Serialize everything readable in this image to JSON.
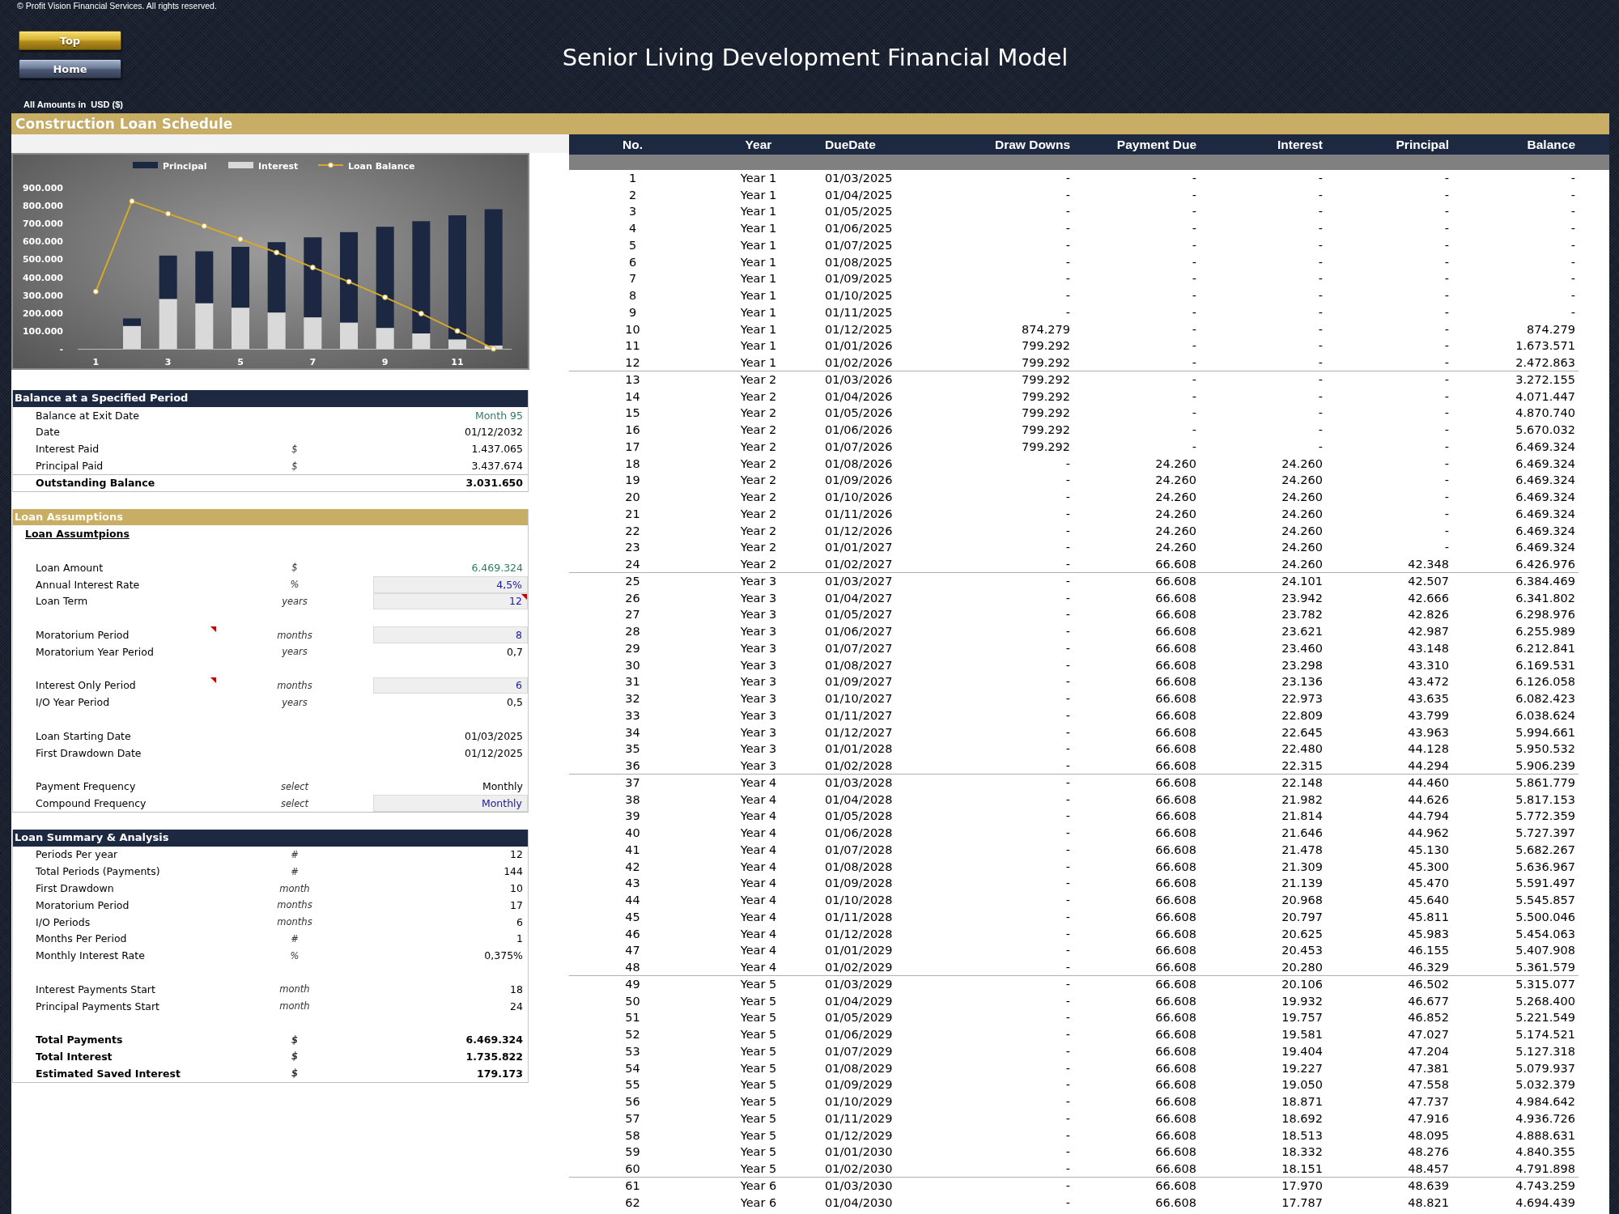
{
  "header": {
    "copyright": "© Profit Vision Financial Services. All rights reserved.",
    "nav_buttons": [
      {
        "label": "Top",
        "kind": "primary"
      },
      {
        "label": "Home",
        "kind": "secondary"
      }
    ],
    "title": "Senior Living Development Financial Model",
    "currency_note": "All Amounts in  USD ($)"
  },
  "section_title": "Construction Loan Schedule",
  "chart": {
    "chart_data": {
      "type": "bar",
      "stacked": true,
      "legend": "top",
      "x": [
        1,
        2,
        3,
        4,
        5,
        6,
        7,
        8,
        9,
        10,
        11,
        12
      ],
      "xlim": [
        0.5,
        12.5
      ],
      "xticks": [
        1,
        3,
        5,
        7,
        9,
        11
      ],
      "series": [
        {
          "name": "Principal",
          "color": "#1c2841",
          "values": [
            0,
            42000,
            242000,
            290000,
            340000,
            393000,
            447000,
            505000,
            565000,
            627000,
            693000,
            761000
          ]
        },
        {
          "name": "Interest",
          "color": "#d9d9d9",
          "values": [
            0,
            128000,
            279000,
            255000,
            230000,
            203000,
            176000,
            147000,
            117000,
            86000,
            53000,
            19000
          ]
        },
        {
          "name": "Loan Balance",
          "type": "line",
          "marker": "circle",
          "color": "#d6a92c",
          "values": [
            320000,
            825000,
            755000,
            686000,
            613000,
            538000,
            455000,
            375000,
            288000,
            197000,
            100000,
            0
          ]
        }
      ],
      "ylim": [
        0,
        900000
      ],
      "yticks": [
        {
          "value": 0,
          "label": "-"
        },
        {
          "value": 100000,
          "label": "100.000"
        },
        {
          "value": 200000,
          "label": "200.000"
        },
        {
          "value": 300000,
          "label": "300.000"
        },
        {
          "value": 400000,
          "label": "400.000"
        },
        {
          "value": 500000,
          "label": "500.000"
        },
        {
          "value": 600000,
          "label": "600.000"
        },
        {
          "value": 700000,
          "label": "700.000"
        },
        {
          "value": 800000,
          "label": "800.000"
        },
        {
          "value": 900000,
          "label": "900.000"
        }
      ]
    }
  },
  "panels": [
    {
      "kind": "primary",
      "title": "Balance at a Specified Period",
      "groups": [
        [
          {
            "label": "Balance at Exit Date",
            "value": "Month 95",
            "kind": "linked"
          },
          {
            "label": "Date",
            "value": "01/12/2032",
            "kind": "plain"
          },
          {
            "label": "Interest Paid",
            "unit": "$",
            "value": "1.437.065",
            "kind": "plain"
          },
          {
            "label": "Principal Paid",
            "unit": "$",
            "value": "3.437.674",
            "kind": "plain"
          },
          {
            "label": "Outstanding Balance",
            "value": "3.031.650",
            "kind": "total"
          }
        ]
      ]
    },
    {
      "kind": "accent",
      "title": "Loan Assumptions",
      "subtitle": "Loan Assumtpions",
      "groups": [
        [
          {
            "label": "Loan Amount",
            "unit": "$",
            "value": "6.469.324",
            "kind": "linked",
            "label_comment": false,
            "value_comment": false
          },
          {
            "label": "Annual Interest Rate",
            "unit": "%",
            "value": "4,5%",
            "kind": "input",
            "label_comment": false,
            "value_comment": false
          },
          {
            "label": "Loan Term",
            "unit": "years",
            "value": "12",
            "kind": "input",
            "label_comment": false,
            "value_comment": true
          }
        ],
        [
          {
            "label": "Moratorium Period",
            "unit": "months",
            "value": "8",
            "kind": "input",
            "label_comment": true,
            "value_comment": false
          },
          {
            "label": "Moratorium Year Period",
            "unit": "years",
            "value": "0,7",
            "kind": "plain",
            "label_comment": false,
            "value_comment": false
          }
        ],
        [
          {
            "label": "Interest Only Period",
            "unit": "months",
            "value": "6",
            "kind": "input",
            "label_comment": true,
            "value_comment": false
          },
          {
            "label": "I/O Year Period",
            "unit": "years",
            "value": "0,5",
            "kind": "plain",
            "label_comment": false,
            "value_comment": false
          }
        ],
        [
          {
            "label": "Loan Starting Date",
            "value": "01/03/2025",
            "kind": "plain",
            "label_comment": false,
            "value_comment": false
          },
          {
            "label": "First Drawdown Date",
            "value": "01/12/2025",
            "kind": "plain",
            "label_comment": false,
            "value_comment": false
          }
        ],
        [
          {
            "label": "Payment Frequency",
            "unit": "select",
            "value": "Monthly",
            "kind": "plain",
            "label_comment": false,
            "value_comment": false
          },
          {
            "label": "Compound Frequency",
            "unit": "select",
            "value": "Monthly",
            "kind": "input",
            "label_comment": false,
            "value_comment": false
          }
        ]
      ]
    },
    {
      "kind": "primary",
      "title": "Loan Summary & Analysis",
      "groups": [
        [
          {
            "label": "Periods Per year",
            "unit": "#",
            "value": "12",
            "kind": "plain"
          },
          {
            "label": "Total Periods (Payments)",
            "unit": "#",
            "value": "144",
            "kind": "plain"
          },
          {
            "label": "First Drawdown",
            "unit": "month",
            "value": "10",
            "kind": "plain"
          },
          {
            "label": "Moratorium Period",
            "unit": "months",
            "value": "17",
            "kind": "plain"
          },
          {
            "label": "I/O Periods",
            "unit": "months",
            "value": "6",
            "kind": "plain"
          },
          {
            "label": "Months Per Period",
            "unit": "#",
            "value": "1",
            "kind": "plain"
          },
          {
            "label": "Monthly Interest Rate",
            "unit": "%",
            "value": "0,375%",
            "kind": "plain"
          }
        ],
        [
          {
            "label": "Interest Payments Start",
            "unit": "month",
            "value": "18",
            "kind": "plain"
          },
          {
            "label": "Principal Payments Start",
            "unit": "month",
            "value": "24",
            "kind": "plain"
          }
        ],
        [
          {
            "label": "Total Payments",
            "unit": "$",
            "value": "6.469.324",
            "kind": "key"
          },
          {
            "label": "Total Interest",
            "unit": "$",
            "value": "1.735.822",
            "kind": "key"
          },
          {
            "label": "Estimated Saved Interest",
            "unit": "$",
            "value": "179.173",
            "kind": "key"
          }
        ]
      ]
    }
  ],
  "schedule_table": {
    "columns": [
      "No.",
      "Year",
      "DueDate",
      "Draw Downs",
      "Payment Due",
      "Interest",
      "Principal",
      "Balance"
    ],
    "row_groups": [
      [
        [
          "1",
          "Year 1",
          "01/03/2025",
          "-",
          "-",
          "-",
          "-",
          "-"
        ],
        [
          "2",
          "Year 1",
          "01/04/2025",
          "-",
          "-",
          "-",
          "-",
          "-"
        ],
        [
          "3",
          "Year 1",
          "01/05/2025",
          "-",
          "-",
          "-",
          "-",
          "-"
        ],
        [
          "4",
          "Year 1",
          "01/06/2025",
          "-",
          "-",
          "-",
          "-",
          "-"
        ],
        [
          "5",
          "Year 1",
          "01/07/2025",
          "-",
          "-",
          "-",
          "-",
          "-"
        ],
        [
          "6",
          "Year 1",
          "01/08/2025",
          "-",
          "-",
          "-",
          "-",
          "-"
        ],
        [
          "7",
          "Year 1",
          "01/09/2025",
          "-",
          "-",
          "-",
          "-",
          "-"
        ],
        [
          "8",
          "Year 1",
          "01/10/2025",
          "-",
          "-",
          "-",
          "-",
          "-"
        ],
        [
          "9",
          "Year 1",
          "01/11/2025",
          "-",
          "-",
          "-",
          "-",
          "-"
        ],
        [
          "10",
          "Year 1",
          "01/12/2025",
          "874.279",
          "-",
          "-",
          "-",
          "874.279"
        ],
        [
          "11",
          "Year 1",
          "01/01/2026",
          "799.292",
          "-",
          "-",
          "-",
          "1.673.571"
        ],
        [
          "12",
          "Year 1",
          "01/02/2026",
          "799.292",
          "-",
          "-",
          "-",
          "2.472.863"
        ]
      ],
      [
        [
          "13",
          "Year 2",
          "01/03/2026",
          "799.292",
          "-",
          "-",
          "-",
          "3.272.155"
        ],
        [
          "14",
          "Year 2",
          "01/04/2026",
          "799.292",
          "-",
          "-",
          "-",
          "4.071.447"
        ],
        [
          "15",
          "Year 2",
          "01/05/2026",
          "799.292",
          "-",
          "-",
          "-",
          "4.870.740"
        ],
        [
          "16",
          "Year 2",
          "01/06/2026",
          "799.292",
          "-",
          "-",
          "-",
          "5.670.032"
        ],
        [
          "17",
          "Year 2",
          "01/07/2026",
          "799.292",
          "-",
          "-",
          "-",
          "6.469.324"
        ],
        [
          "18",
          "Year 2",
          "01/08/2026",
          "-",
          "24.260",
          "24.260",
          "-",
          "6.469.324"
        ],
        [
          "19",
          "Year 2",
          "01/09/2026",
          "-",
          "24.260",
          "24.260",
          "-",
          "6.469.324"
        ],
        [
          "20",
          "Year 2",
          "01/10/2026",
          "-",
          "24.260",
          "24.260",
          "-",
          "6.469.324"
        ],
        [
          "21",
          "Year 2",
          "01/11/2026",
          "-",
          "24.260",
          "24.260",
          "-",
          "6.469.324"
        ],
        [
          "22",
          "Year 2",
          "01/12/2026",
          "-",
          "24.260",
          "24.260",
          "-",
          "6.469.324"
        ],
        [
          "23",
          "Year 2",
          "01/01/2027",
          "-",
          "24.260",
          "24.260",
          "-",
          "6.469.324"
        ],
        [
          "24",
          "Year 2",
          "01/02/2027",
          "-",
          "66.608",
          "24.260",
          "42.348",
          "6.426.976"
        ]
      ],
      [
        [
          "25",
          "Year 3",
          "01/03/2027",
          "-",
          "66.608",
          "24.101",
          "42.507",
          "6.384.469"
        ],
        [
          "26",
          "Year 3",
          "01/04/2027",
          "-",
          "66.608",
          "23.942",
          "42.666",
          "6.341.802"
        ],
        [
          "27",
          "Year 3",
          "01/05/2027",
          "-",
          "66.608",
          "23.782",
          "42.826",
          "6.298.976"
        ],
        [
          "28",
          "Year 3",
          "01/06/2027",
          "-",
          "66.608",
          "23.621",
          "42.987",
          "6.255.989"
        ],
        [
          "29",
          "Year 3",
          "01/07/2027",
          "-",
          "66.608",
          "23.460",
          "43.148",
          "6.212.841"
        ],
        [
          "30",
          "Year 3",
          "01/08/2027",
          "-",
          "66.608",
          "23.298",
          "43.310",
          "6.169.531"
        ],
        [
          "31",
          "Year 3",
          "01/09/2027",
          "-",
          "66.608",
          "23.136",
          "43.472",
          "6.126.058"
        ],
        [
          "32",
          "Year 3",
          "01/10/2027",
          "-",
          "66.608",
          "22.973",
          "43.635",
          "6.082.423"
        ],
        [
          "33",
          "Year 3",
          "01/11/2027",
          "-",
          "66.608",
          "22.809",
          "43.799",
          "6.038.624"
        ],
        [
          "34",
          "Year 3",
          "01/12/2027",
          "-",
          "66.608",
          "22.645",
          "43.963",
          "5.994.661"
        ],
        [
          "35",
          "Year 3",
          "01/01/2028",
          "-",
          "66.608",
          "22.480",
          "44.128",
          "5.950.532"
        ],
        [
          "36",
          "Year 3",
          "01/02/2028",
          "-",
          "66.608",
          "22.315",
          "44.294",
          "5.906.239"
        ]
      ],
      [
        [
          "37",
          "Year 4",
          "01/03/2028",
          "-",
          "66.608",
          "22.148",
          "44.460",
          "5.861.779"
        ],
        [
          "38",
          "Year 4",
          "01/04/2028",
          "-",
          "66.608",
          "21.982",
          "44.626",
          "5.817.153"
        ],
        [
          "39",
          "Year 4",
          "01/05/2028",
          "-",
          "66.608",
          "21.814",
          "44.794",
          "5.772.359"
        ],
        [
          "40",
          "Year 4",
          "01/06/2028",
          "-",
          "66.608",
          "21.646",
          "44.962",
          "5.727.397"
        ],
        [
          "41",
          "Year 4",
          "01/07/2028",
          "-",
          "66.608",
          "21.478",
          "45.130",
          "5.682.267"
        ],
        [
          "42",
          "Year 4",
          "01/08/2028",
          "-",
          "66.608",
          "21.309",
          "45.300",
          "5.636.967"
        ],
        [
          "43",
          "Year 4",
          "01/09/2028",
          "-",
          "66.608",
          "21.139",
          "45.470",
          "5.591.497"
        ],
        [
          "44",
          "Year 4",
          "01/10/2028",
          "-",
          "66.608",
          "20.968",
          "45.640",
          "5.545.857"
        ],
        [
          "45",
          "Year 4",
          "01/11/2028",
          "-",
          "66.608",
          "20.797",
          "45.811",
          "5.500.046"
        ],
        [
          "46",
          "Year 4",
          "01/12/2028",
          "-",
          "66.608",
          "20.625",
          "45.983",
          "5.454.063"
        ],
        [
          "47",
          "Year 4",
          "01/01/2029",
          "-",
          "66.608",
          "20.453",
          "46.155",
          "5.407.908"
        ],
        [
          "48",
          "Year 4",
          "01/02/2029",
          "-",
          "66.608",
          "20.280",
          "46.329",
          "5.361.579"
        ]
      ],
      [
        [
          "49",
          "Year 5",
          "01/03/2029",
          "-",
          "66.608",
          "20.106",
          "46.502",
          "5.315.077"
        ],
        [
          "50",
          "Year 5",
          "01/04/2029",
          "-",
          "66.608",
          "19.932",
          "46.677",
          "5.268.400"
        ],
        [
          "51",
          "Year 5",
          "01/05/2029",
          "-",
          "66.608",
          "19.757",
          "46.852",
          "5.221.549"
        ],
        [
          "52",
          "Year 5",
          "01/06/2029",
          "-",
          "66.608",
          "19.581",
          "47.027",
          "5.174.521"
        ],
        [
          "53",
          "Year 5",
          "01/07/2029",
          "-",
          "66.608",
          "19.404",
          "47.204",
          "5.127.318"
        ],
        [
          "54",
          "Year 5",
          "01/08/2029",
          "-",
          "66.608",
          "19.227",
          "47.381",
          "5.079.937"
        ],
        [
          "55",
          "Year 5",
          "01/09/2029",
          "-",
          "66.608",
          "19.050",
          "47.558",
          "5.032.379"
        ],
        [
          "56",
          "Year 5",
          "01/10/2029",
          "-",
          "66.608",
          "18.871",
          "47.737",
          "4.984.642"
        ],
        [
          "57",
          "Year 5",
          "01/11/2029",
          "-",
          "66.608",
          "18.692",
          "47.916",
          "4.936.726"
        ],
        [
          "58",
          "Year 5",
          "01/12/2029",
          "-",
          "66.608",
          "18.513",
          "48.095",
          "4.888.631"
        ],
        [
          "59",
          "Year 5",
          "01/01/2030",
          "-",
          "66.608",
          "18.332",
          "48.276",
          "4.840.355"
        ],
        [
          "60",
          "Year 5",
          "01/02/2030",
          "-",
          "66.608",
          "18.151",
          "48.457",
          "4.791.898"
        ]
      ],
      [
        [
          "61",
          "Year 6",
          "01/03/2030",
          "-",
          "66.608",
          "17.970",
          "48.639",
          "4.743.259"
        ],
        [
          "62",
          "Year 6",
          "01/04/2030",
          "-",
          "66.608",
          "17.787",
          "48.821",
          "4.694.439"
        ]
      ]
    ]
  }
}
